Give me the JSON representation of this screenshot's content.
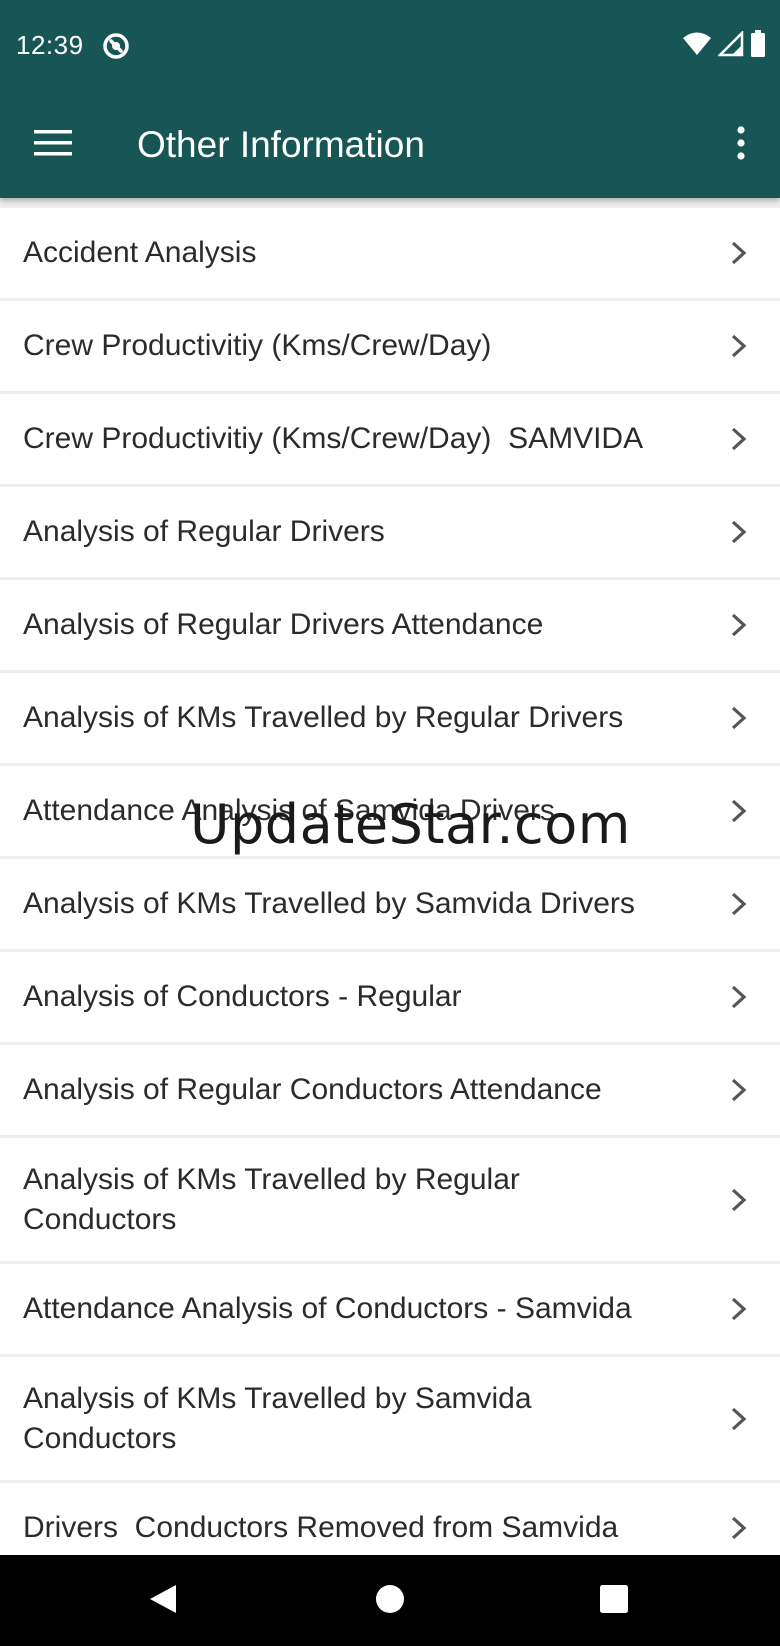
{
  "status_bar": {
    "time": "12:39",
    "icons": [
      "app-notification-icon",
      "wifi-icon",
      "cellular-signal-icon",
      "battery-icon"
    ]
  },
  "app_bar": {
    "title": "Other Information",
    "background": "#185656",
    "icons": [
      "hamburger-menu-icon",
      "more-vert-icon"
    ]
  },
  "list": {
    "items": [
      {
        "label": "Accident Analysis"
      },
      {
        "label": "Crew Productivitiy (Kms/Crew/Day)"
      },
      {
        "label": "Crew Productivitiy (Kms/Crew/Day)  SAMVIDA"
      },
      {
        "label": "Analysis of Regular Drivers"
      },
      {
        "label": "Analysis of Regular Drivers Attendance"
      },
      {
        "label": "Analysis of KMs Travelled by Regular Drivers"
      },
      {
        "label": "Attendance Analysis of Samvida Drivers"
      },
      {
        "label": "Analysis of KMs Travelled by Samvida Drivers"
      },
      {
        "label": "Analysis of Conductors - Regular"
      },
      {
        "label": "Analysis of Regular Conductors Attendance"
      },
      {
        "label": "Analysis of KMs Travelled by Regular\nConductors"
      },
      {
        "label": "Attendance Analysis of Conductors - Samvida"
      },
      {
        "label": "Analysis of KMs Travelled by Samvida\nConductors"
      },
      {
        "label": "Drivers  Conductors Removed from Samvida"
      }
    ]
  },
  "watermark": "UpdateStar.com",
  "nav_bar": {
    "icons": [
      "back-icon",
      "home-icon",
      "recents-icon"
    ]
  }
}
